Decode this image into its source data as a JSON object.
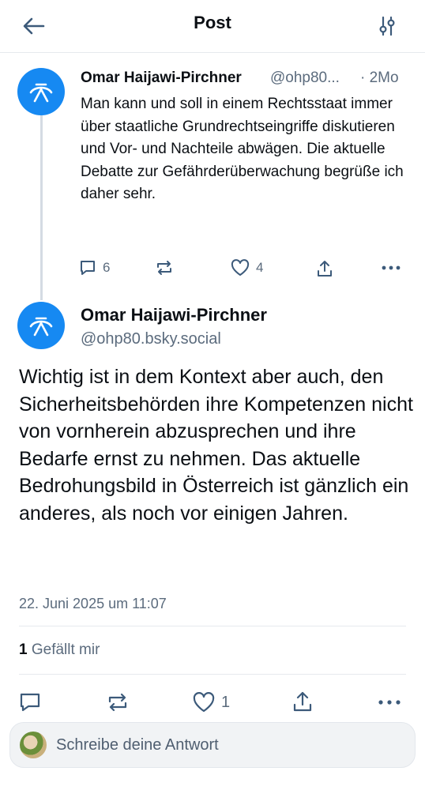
{
  "header": {
    "title": "Post"
  },
  "parent_post": {
    "author_name": "Omar Haijawi-Pirchner",
    "handle": "@ohp80...",
    "time": "· 2Mo",
    "text": "Man kann und soll in einem Rechtsstaat immer über staatliche Grundrechtseingriffe diskutieren und Vor- und Nachteile abwägen. Die aktuelle Debatte zur Gefährderüberwachung begrüße ich daher sehr.",
    "reply_count": "6",
    "like_count": "4"
  },
  "main_post": {
    "author_name": "Omar Haijawi-Pirchner",
    "handle": "@ohp80.bsky.social",
    "text": "Wichtig ist in dem Kontext aber auch, den Sicherheitsbehörden ihre Kompetenzen nicht von vornherein abzusprechen und ihre Bedarfe ernst zu nehmen. Das aktuelle Bedrohungsbild in Österreich ist gänzlich ein anderes, als noch vor einigen Jahren.",
    "date": "22. Juni 2025 um 11:07",
    "likes_count": "1",
    "likes_label": "Gefällt mir",
    "like_action_count": "1"
  },
  "reply": {
    "placeholder": "Schreibe deine Antwort"
  },
  "colors": {
    "accent": "#1689f2",
    "muted": "#5b6b7d",
    "divider": "#e6e9ee"
  }
}
